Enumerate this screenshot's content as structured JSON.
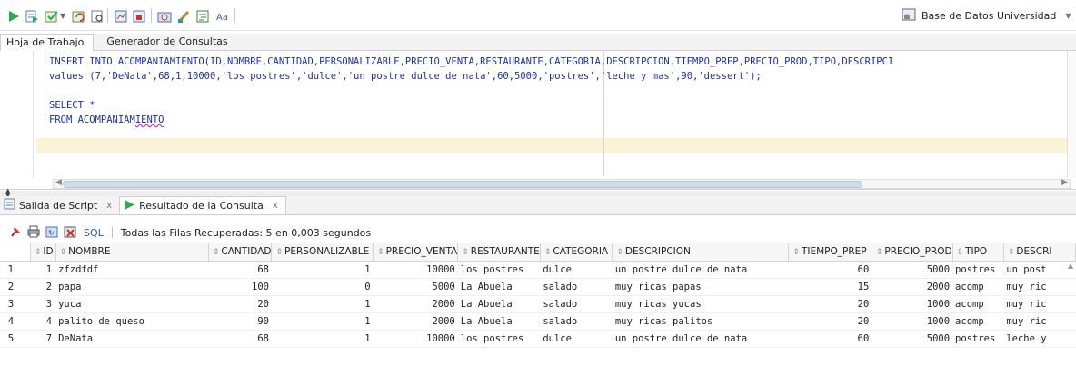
{
  "connection": {
    "label": "Base de Datos Universidad"
  },
  "worksheet_tabs": [
    {
      "label": "Hoja de Trabajo"
    },
    {
      "label": "Generador de Consultas"
    }
  ],
  "editor": {
    "lines": [
      "INSERT INTO ACOMPANIAMIENTO(ID,NOMBRE,CANTIDAD,PERSONALIZABLE,PRECIO_VENTA,RESTAURANTE,CATEGORIA,DESCRIPCION,TIEMPO_PREP,PRECIO_PROD,TIPO,DESCRIPCI",
      "values (7,'DeNata',68,1,10000,'los postres','dulce','un postre dulce de nata',60,5000,'postres','leche y mas',90,'dessert');",
      "",
      "SELECT *",
      "FROM ACOMPANIAMIENTO"
    ]
  },
  "output_tabs": [
    {
      "label": "Salida de Script",
      "close": "x"
    },
    {
      "label": "Resultado de la Consulta",
      "close": "x"
    }
  ],
  "result_toolbar": {
    "sql_label": "SQL",
    "status": "Todas las Filas Recuperadas: 5 en 0,003 segundos"
  },
  "grid": {
    "columns": [
      "ID",
      "NOMBRE",
      "CANTIDAD",
      "PERSONALIZABLE",
      "PRECIO_VENTA",
      "RESTAURANTE",
      "CATEGORIA",
      "DESCRIPCION",
      "TIEMPO_PREP",
      "PRECIO_PROD",
      "TIPO",
      "DESCRI"
    ],
    "rows": [
      [
        "1",
        "1",
        "zfzdfdf",
        "68",
        "1",
        "10000",
        "los postres",
        "dulce",
        "un postre dulce de nata",
        "60",
        "5000",
        "postres",
        "un post"
      ],
      [
        "2",
        "2",
        "papa",
        "100",
        "0",
        "5000",
        "La Abuela",
        "salado",
        "muy ricas papas",
        "15",
        "2000",
        "acomp",
        "muy ric"
      ],
      [
        "3",
        "3",
        "yuca",
        "20",
        "1",
        "2000",
        "La Abuela",
        "salado",
        "muy ricas yucas",
        "20",
        "1000",
        "acomp",
        "muy ric"
      ],
      [
        "4",
        "4",
        "palito de queso",
        "90",
        "1",
        "2000",
        "La Abuela",
        "salado",
        "muy ricas palitos",
        "20",
        "1000",
        "acomp",
        "muy ric"
      ],
      [
        "5",
        "7",
        "DeNata",
        "68",
        "1",
        "10000",
        "los postres",
        "dulce",
        "un postre dulce de nata",
        "60",
        "5000",
        "postres",
        "leche y"
      ]
    ]
  },
  "colors": {
    "keyword": "#1d2fa8",
    "current_line": "#fbf3d6",
    "sql_link": "#2a55b6"
  }
}
